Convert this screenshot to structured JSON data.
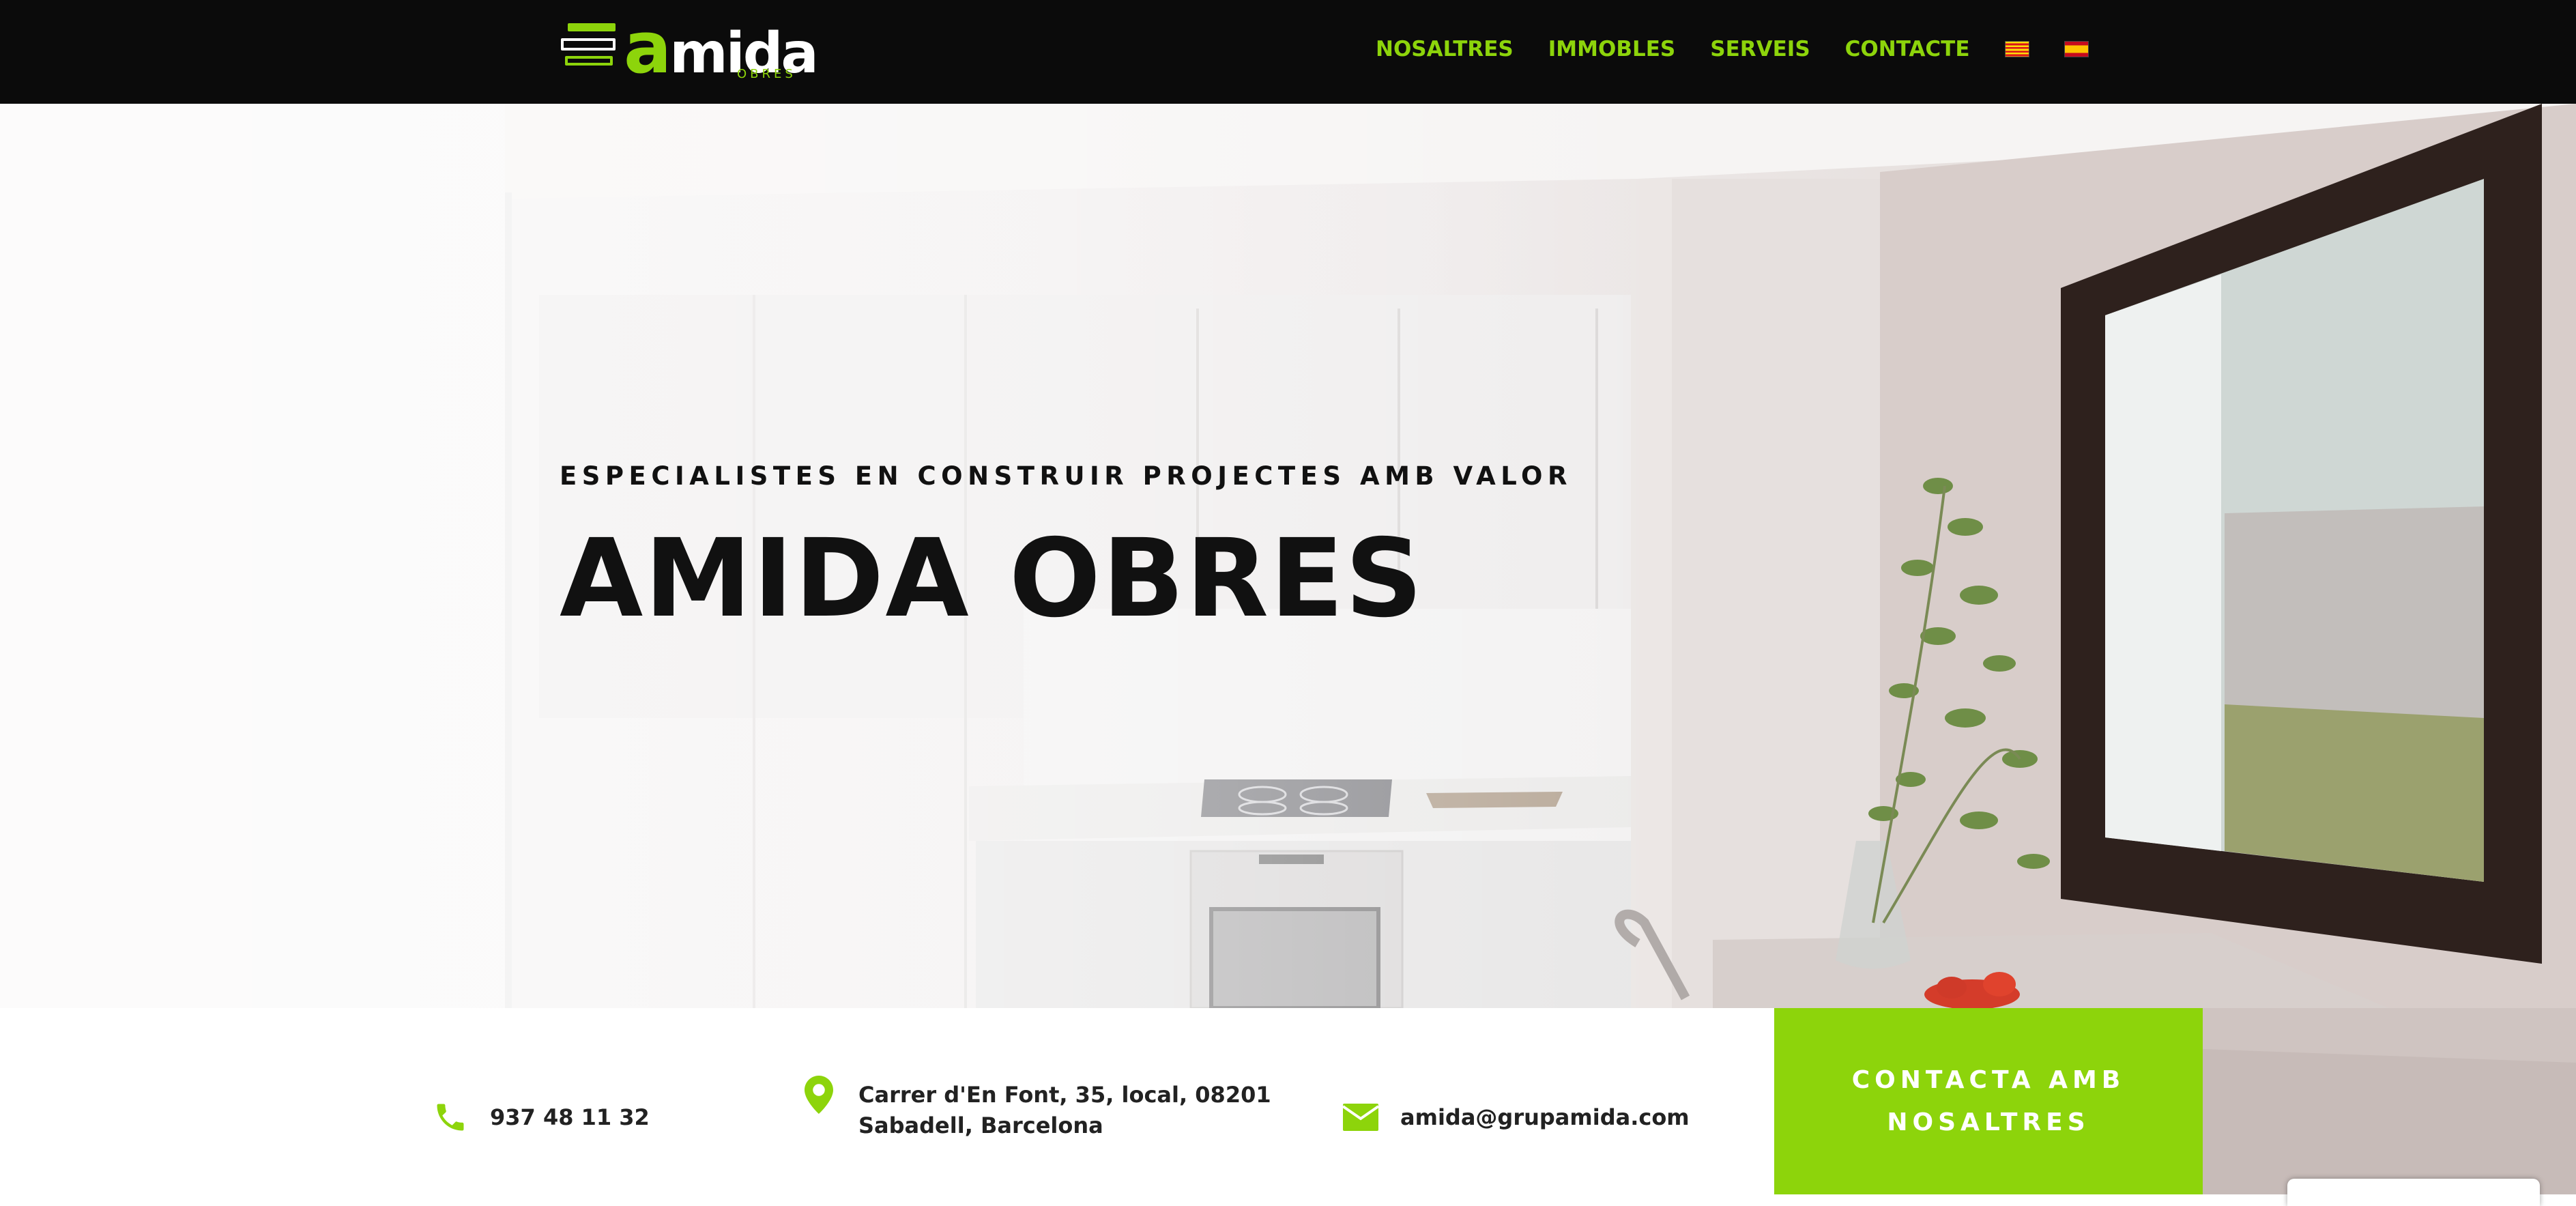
{
  "header": {
    "logo": {
      "word_first": "a",
      "word_rest": "mida",
      "sub": "OBRES"
    },
    "nav": [
      {
        "label": "NOSALTRES"
      },
      {
        "label": "IMMOBLES"
      },
      {
        "label": "SERVEIS"
      },
      {
        "label": "CONTACTE"
      }
    ],
    "languages": [
      {
        "icon": "catalan-flag-icon"
      },
      {
        "icon": "spanish-flag-icon"
      }
    ]
  },
  "hero": {
    "subtitle": "ESPECIALISTES EN CONSTRUIR PROJECTES AMB VALOR",
    "title": "AMIDA OBRES"
  },
  "contact": {
    "phone": "937 48 11 32",
    "address_line1": "Carrer d'En Font, 35, local, 08201",
    "address_line2": "Sabadell, Barcelona",
    "email": "amida@grupamida.com"
  },
  "cta": {
    "line1": "CONTACTA AMB",
    "line2": "NOSALTRES"
  },
  "colors": {
    "brand_green": "#8dd40b",
    "header_bg": "#0b0b0b",
    "text_dark": "#111111"
  }
}
